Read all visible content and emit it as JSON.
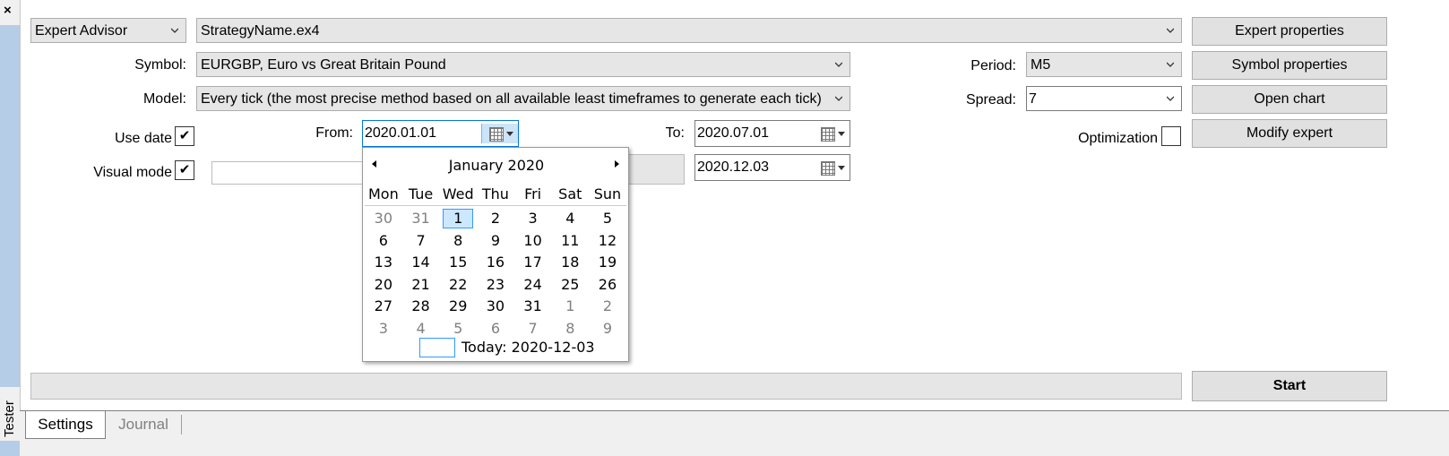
{
  "window": {
    "close_glyph": "×",
    "side_tab_label": "Tester"
  },
  "settings": {
    "mode_select": {
      "value": "Expert Advisor"
    },
    "expert_select": {
      "value": "StrategyName.ex4"
    },
    "symbol": {
      "label": "Symbol:",
      "value": "EURGBP, Euro vs Great Britain Pound"
    },
    "model": {
      "label": "Model:",
      "value": "Every tick (the most precise method based on all available least timeframes to generate each tick)"
    },
    "period": {
      "label": "Period:",
      "value": "M5"
    },
    "spread": {
      "label": "Spread:",
      "value": "7"
    },
    "use_date": {
      "label": "Use date",
      "checked": true,
      "check_glyph": "✔"
    },
    "from": {
      "label": "From:",
      "value": "2020.01.01"
    },
    "to": {
      "label": "To:",
      "value": "2020.07.01"
    },
    "visual_mode": {
      "label": "Visual mode",
      "checked": true,
      "check_glyph": "✔",
      "skip_to_value": "2020.12.03"
    },
    "optimization": {
      "label": "Optimization",
      "checked": false
    }
  },
  "buttons": {
    "expert_properties": "Expert properties",
    "symbol_properties": "Symbol properties",
    "open_chart": "Open chart",
    "modify_expert": "Modify expert",
    "start": "Start"
  },
  "calendar": {
    "month_title": "January 2020",
    "weekdays": [
      "Mon",
      "Tue",
      "Wed",
      "Thu",
      "Fri",
      "Sat",
      "Sun"
    ],
    "weeks": [
      [
        "30",
        "31",
        "1",
        "2",
        "3",
        "4",
        "5"
      ],
      [
        "6",
        "7",
        "8",
        "9",
        "10",
        "11",
        "12"
      ],
      [
        "13",
        "14",
        "15",
        "16",
        "17",
        "18",
        "19"
      ],
      [
        "20",
        "21",
        "22",
        "23",
        "24",
        "25",
        "26"
      ],
      [
        "27",
        "28",
        "29",
        "30",
        "31",
        "1",
        "2"
      ],
      [
        "3",
        "4",
        "5",
        "6",
        "7",
        "8",
        "9"
      ]
    ],
    "muted": [
      [
        true,
        true,
        false,
        false,
        false,
        false,
        false
      ],
      [
        false,
        false,
        false,
        false,
        false,
        false,
        false
      ],
      [
        false,
        false,
        false,
        false,
        false,
        false,
        false
      ],
      [
        false,
        false,
        false,
        false,
        false,
        false,
        false
      ],
      [
        false,
        false,
        false,
        false,
        false,
        true,
        true
      ],
      [
        true,
        true,
        true,
        true,
        true,
        true,
        true
      ]
    ],
    "selected": {
      "week": 0,
      "day": 2
    },
    "today_label": "Today: 2020-12-03"
  },
  "tabs": {
    "settings": "Settings",
    "journal": "Journal"
  },
  "colors": {
    "sidebar": "#b5cde6",
    "selection": "#cce8ff",
    "selection_border": "#3399ff"
  }
}
